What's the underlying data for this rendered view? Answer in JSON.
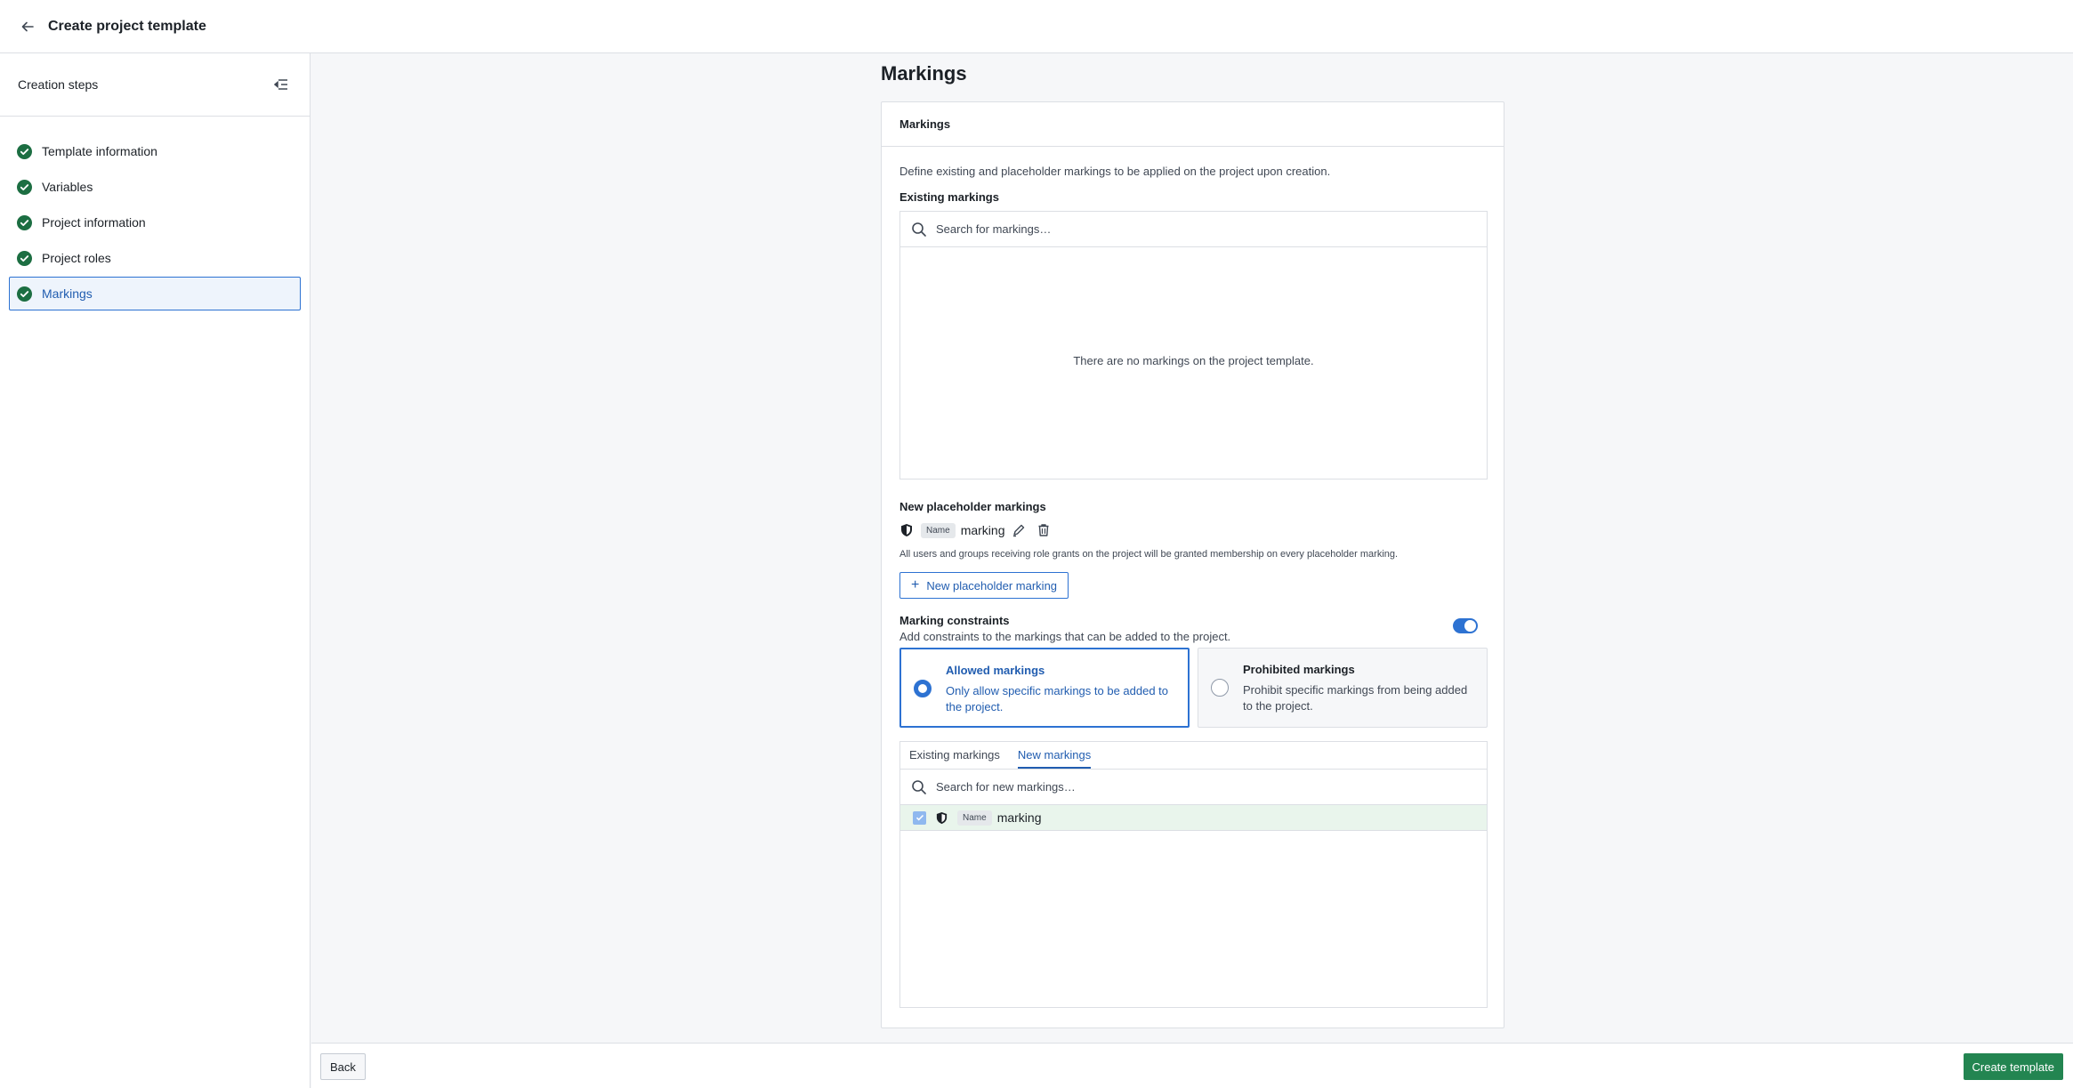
{
  "header": {
    "title": "Create project template"
  },
  "sidebar": {
    "heading": "Creation steps",
    "steps": [
      {
        "label": "Template information",
        "status": "complete"
      },
      {
        "label": "Variables",
        "status": "complete"
      },
      {
        "label": "Project information",
        "status": "complete"
      },
      {
        "label": "Project roles",
        "status": "complete"
      },
      {
        "label": "Markings",
        "status": "complete",
        "active": true
      }
    ]
  },
  "main": {
    "page_title": "Markings",
    "card_title": "Markings",
    "description": "Define existing and placeholder markings to be applied on the project upon creation.",
    "existing": {
      "label": "Existing markings",
      "search_placeholder": "Search for markings…",
      "empty_message": "There are no markings on the project template."
    },
    "placeholder": {
      "label": "New placeholder markings",
      "tag": "Name",
      "marking_name": "marking",
      "note": "All users and groups receiving role grants on the project will be granted membership on every placeholder marking.",
      "add_button": "New placeholder marking"
    },
    "constraints": {
      "label": "Marking constraints",
      "description": "Add constraints to the markings that can be added to the project.",
      "enabled": true,
      "options": [
        {
          "title": "Allowed markings",
          "description": "Only allow specific markings to be added to the project.",
          "selected": true
        },
        {
          "title": "Prohibited markings",
          "description": "Prohibit specific markings from being added to the project.",
          "selected": false
        }
      ],
      "tabs": [
        {
          "label": "Existing markings",
          "active": false
        },
        {
          "label": "New markings",
          "active": true
        }
      ],
      "search_placeholder": "Search for new markings…",
      "items": [
        {
          "tag": "Name",
          "name": "marking",
          "checked": true
        }
      ]
    }
  },
  "footer": {
    "back_label": "Back",
    "create_label": "Create template"
  },
  "colors": {
    "accent": "#2d72d2",
    "success": "#238551",
    "check": "#1c6e42"
  }
}
